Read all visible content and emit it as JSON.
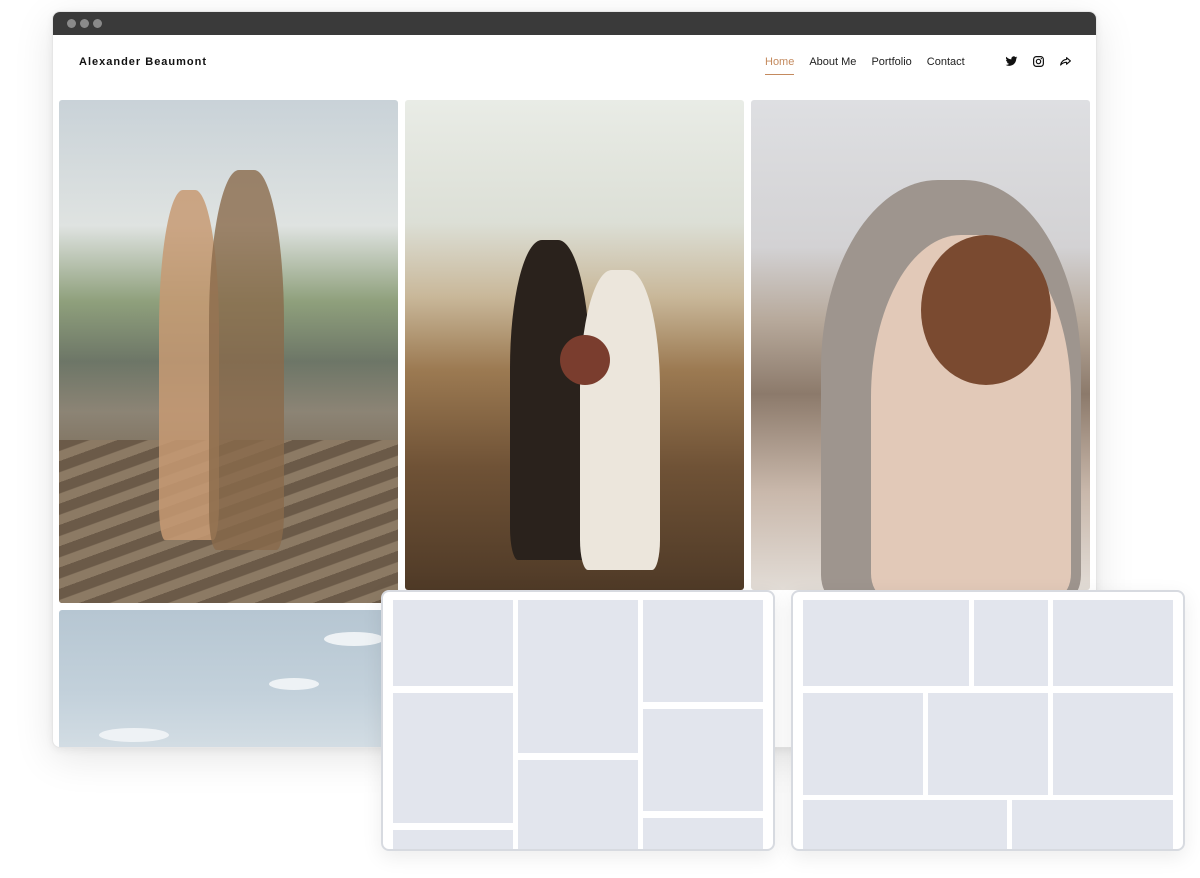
{
  "site": {
    "brand": "Alexander Beaumont",
    "nav": [
      {
        "label": "Home",
        "active": true
      },
      {
        "label": "About Me",
        "active": false
      },
      {
        "label": "Portfolio",
        "active": false
      },
      {
        "label": "Contact",
        "active": false
      }
    ],
    "social_icons": [
      "twitter-icon",
      "instagram-icon",
      "share-icon"
    ]
  },
  "gallery": {
    "photos": [
      "couple-on-dock-photo",
      "couple-on-beach-photo",
      "couple-embrace-photo",
      "sky-photo"
    ]
  },
  "layout_cards": [
    "masonry-layout-card",
    "grid-layout-card"
  ],
  "colors": {
    "accent": "#c48a5e",
    "titlebar": "#3a3a3a",
    "placeholder_tile": "#e2e5ed",
    "card_border": "#d7dae0"
  }
}
